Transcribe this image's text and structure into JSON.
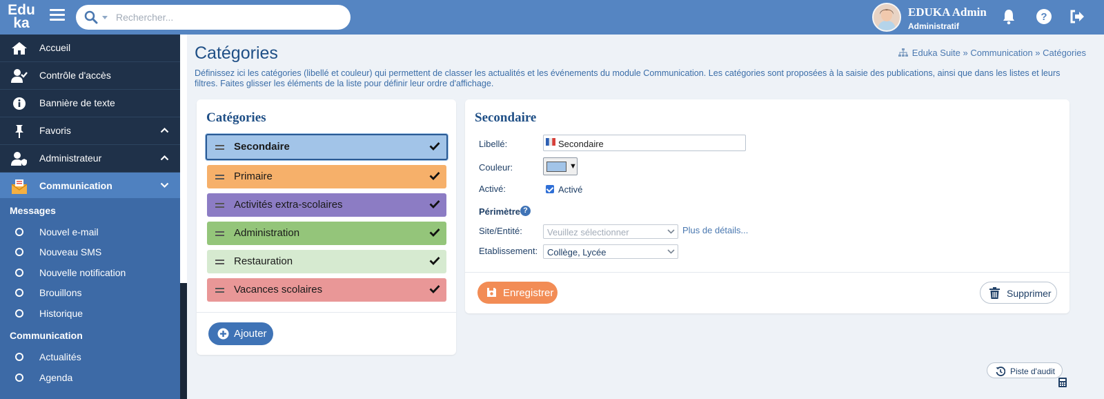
{
  "topbar": {
    "logo_line1": "Edu",
    "logo_line2": "ka",
    "search_placeholder": "Rechercher...",
    "user_name": "EDUKA Admin",
    "user_role": "Administratif"
  },
  "colors": {
    "topbar": "#5585c2",
    "sidebar": "#1f3149",
    "sidebar_active": "#4f81c0",
    "submenu": "#3d6aa6",
    "save_button": "#f28c55",
    "add_button": "#3f73b6"
  },
  "sidebar": {
    "items": [
      {
        "label": "Accueil",
        "icon": "home-icon"
      },
      {
        "label": "Contrôle d'accès",
        "icon": "user-check-icon"
      },
      {
        "label": "Bannière de texte",
        "icon": "info-icon"
      },
      {
        "label": "Favoris",
        "icon": "pin-icon"
      },
      {
        "label": "Administrateur",
        "icon": "user-shield-icon"
      },
      {
        "label": "Communication",
        "icon": "envelope-icon"
      }
    ],
    "sub_groups": [
      {
        "title": "Messages",
        "items": [
          "Nouvel e-mail",
          "Nouveau SMS",
          "Nouvelle notification",
          "Brouillons",
          "Historique"
        ]
      },
      {
        "title": "Communication",
        "items": [
          "Actualités",
          "Agenda"
        ]
      }
    ]
  },
  "page": {
    "title": "Catégories",
    "breadcrumb": "Eduka Suite » Communication » Catégories",
    "description": "Définissez ici les catégories (libellé et couleur) qui permettent de classer les actualités et les événements du module Communication. Les catégories sont proposées à la saisie des publications, ainsi que dans les listes et leurs filtres. Faites glisser les éléments de la liste pour définir leur ordre d'affichage."
  },
  "categories_panel": {
    "title": "Catégories",
    "items": [
      {
        "label": "Secondaire",
        "color": "#a2c4e8"
      },
      {
        "label": "Primaire",
        "color": "#f6b06a"
      },
      {
        "label": "Activités extra-scolaires",
        "color": "#8c7cc4"
      },
      {
        "label": "Administration",
        "color": "#94c57a"
      },
      {
        "label": "Restauration",
        "color": "#d6ead0"
      },
      {
        "label": "Vacances scolaires",
        "color": "#e99797"
      }
    ],
    "add_label": "Ajouter"
  },
  "detail": {
    "title": "Secondaire",
    "libelle_label": "Libellé:",
    "libelle_value": "Secondaire",
    "couleur_label": "Couleur:",
    "couleur_value": "#a2c4e8",
    "active_label": "Activé:",
    "active_checkbox_label": "Activé",
    "active": true,
    "perimetre_label": "Périmètre",
    "site_label": "Site/Entité:",
    "site_placeholder": "Veuillez sélectionner",
    "more_details": "Plus de détails...",
    "etab_label": "Etablissement:",
    "etab_value": "Collège, Lycée",
    "save_label": "Enregistrer",
    "delete_label": "Supprimer"
  },
  "audit_label": "Piste d'audit"
}
